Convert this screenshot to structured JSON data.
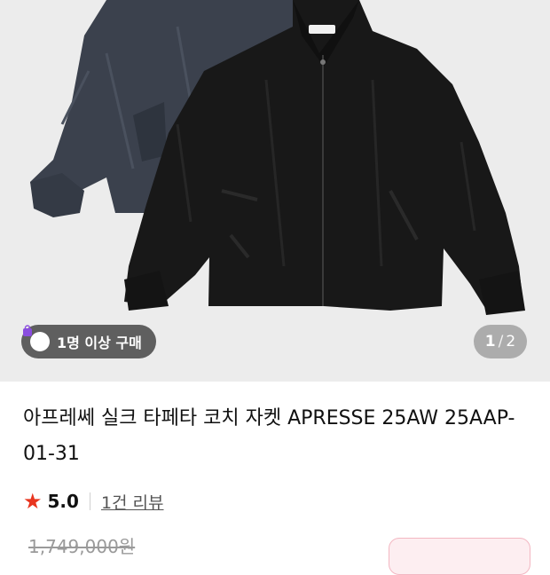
{
  "gallery": {
    "badge_label": "1명 이상 구매",
    "badge_icon": "shopping-bag-icon",
    "counter_current": "1",
    "counter_separator": "/",
    "counter_total": "2"
  },
  "product": {
    "title": "아프레쎄 실크 타페타 코치 자켓 APRESSE 25AW 25AAP-01-31"
  },
  "rating": {
    "star_icon": "star-icon",
    "star_color": "#e8351f",
    "score": "5.0",
    "reviews_label": "1건 리뷰"
  },
  "price": {
    "original": "1,749,000원"
  }
}
